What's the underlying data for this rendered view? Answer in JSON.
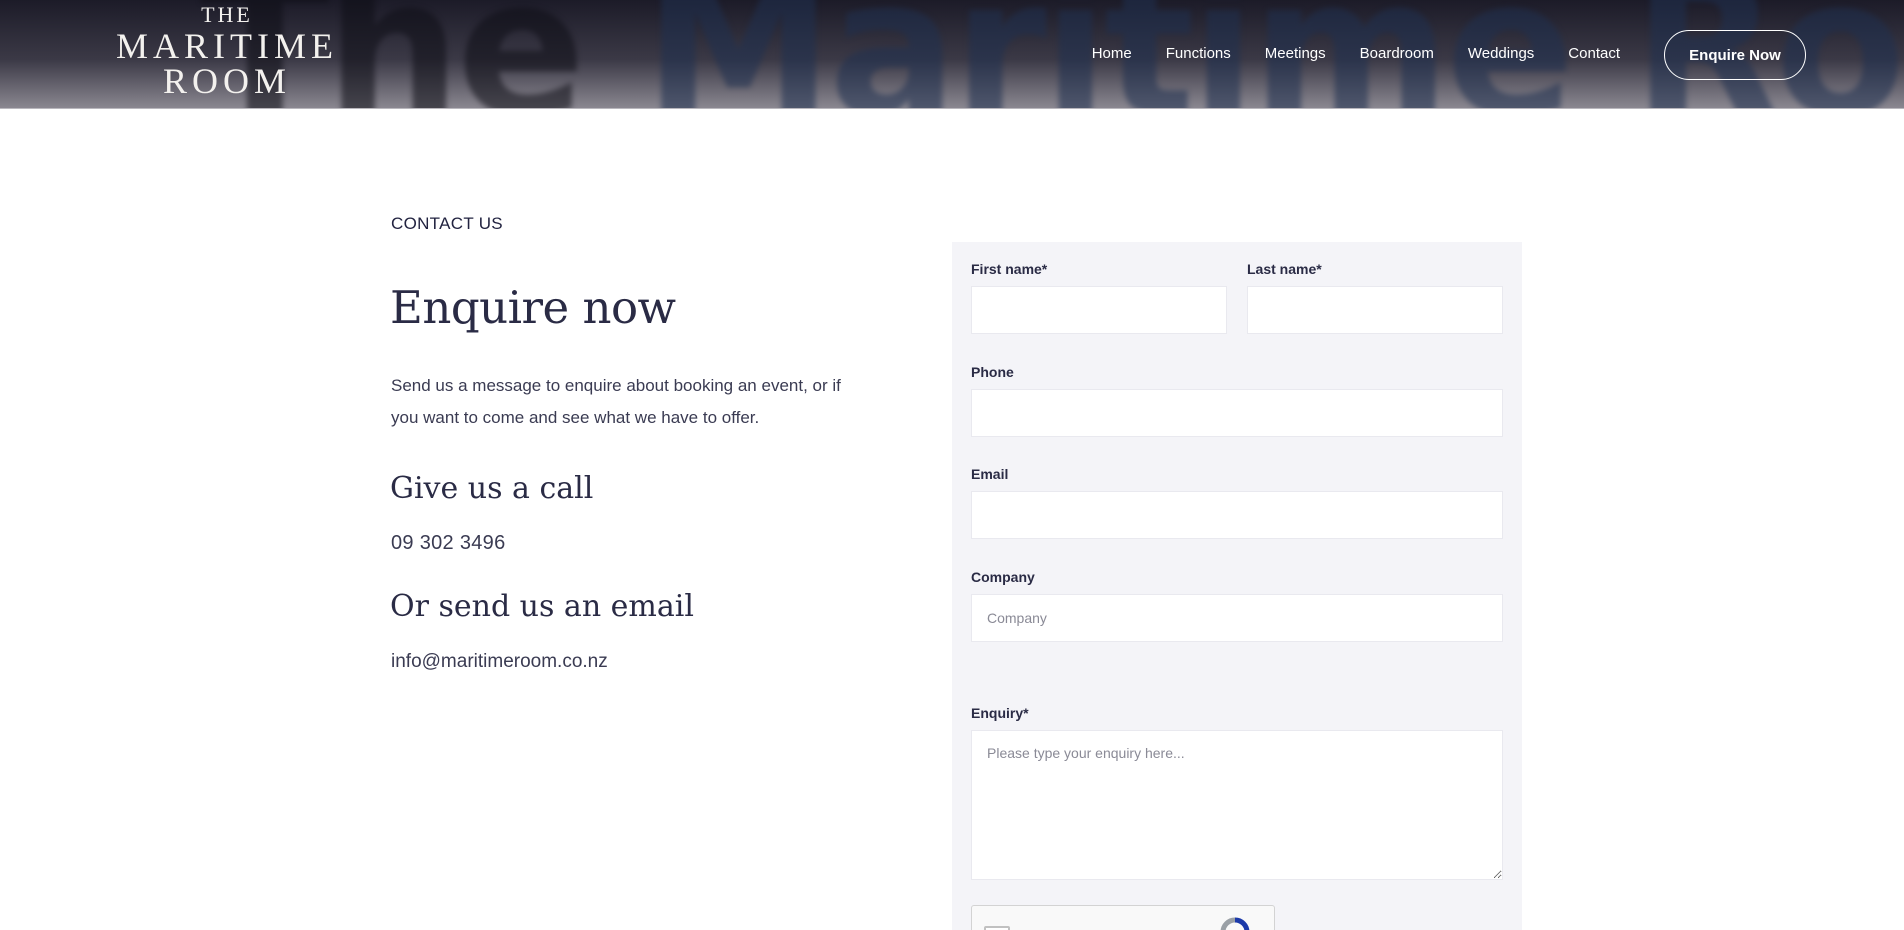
{
  "header": {
    "logo": {
      "line1": "THE",
      "line2": "MARITIME",
      "line3": "ROOM"
    },
    "background_text": {
      "part1": "The ",
      "part2": "Maritime Room"
    },
    "nav": [
      {
        "label": "Home"
      },
      {
        "label": "Functions"
      },
      {
        "label": "Meetings"
      },
      {
        "label": "Boardroom"
      },
      {
        "label": "Weddings"
      },
      {
        "label": "Contact"
      }
    ],
    "cta_label": "Enquire Now"
  },
  "contact": {
    "eyebrow": "CONTACT US",
    "title": "Enquire now",
    "intro": "Send us a message to enquire about booking an event, or if you want to come and see what we have to offer.",
    "call_heading": "Give us a call",
    "phone": "09 302 3496",
    "email_heading": "Or send us an email",
    "email": "info@maritimeroom.co.nz"
  },
  "form": {
    "first_name_label": "First name*",
    "first_name_value": "",
    "last_name_label": "Last name*",
    "last_name_value": "",
    "phone_label": "Phone",
    "phone_value": "",
    "email_label": "Email",
    "email_value": "",
    "company_label": "Company",
    "company_placeholder": "Company",
    "company_value": "",
    "enquiry_label": "Enquiry*",
    "enquiry_placeholder": "Please type your enquiry here...",
    "enquiry_value": ""
  },
  "colors": {
    "text_dark": "#2a2b45",
    "form_bg": "#f4f4f8",
    "header_dark": "#1c1b28"
  }
}
